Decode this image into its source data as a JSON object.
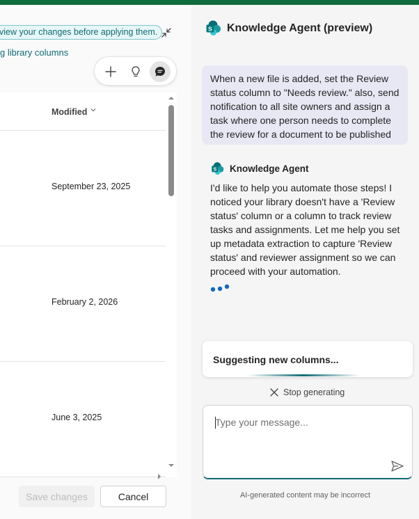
{
  "left": {
    "review_banner": "view your changes before applying them.",
    "library_link": "g library columns",
    "table": {
      "column_header": "Modified",
      "rows": [
        {
          "modified": "September 23, 2025"
        },
        {
          "modified": "February 2, 2026"
        },
        {
          "modified": "June 3, 2025"
        }
      ]
    },
    "save_label": "Save changes",
    "cancel_label": "Cancel"
  },
  "panel": {
    "title": "Knowledge Agent (preview)",
    "user_message": "When a new file is added, set the Review status column to \"Needs review.\" also, send notification to all site owners and assign a task where one person needs to complete the review for a document to be published",
    "agent_name": "Knowledge Agent",
    "agent_message": "I'd like to help you automate those steps! I noticed your library doesn't have a 'Review status' column or a column to track review tasks and assignments. Let me help you set up metadata extraction to capture 'Review status' and reviewer assignment so we can proceed with your automation.",
    "suggesting": "Suggesting new columns...",
    "stop_label": "Stop generating",
    "input_placeholder": "Type your message...",
    "disclaimer": "AI-generated content may be incorrect"
  },
  "colors": {
    "brand": "#0f6c3c",
    "accent": "#0f6b73",
    "user_bubble": "#e8e8f5"
  },
  "icons": [
    "collapse-icon",
    "plus-icon",
    "lightbulb-icon",
    "chat-icon",
    "sharepoint-logo-icon",
    "close-icon",
    "send-icon",
    "chevron-down-icon"
  ]
}
